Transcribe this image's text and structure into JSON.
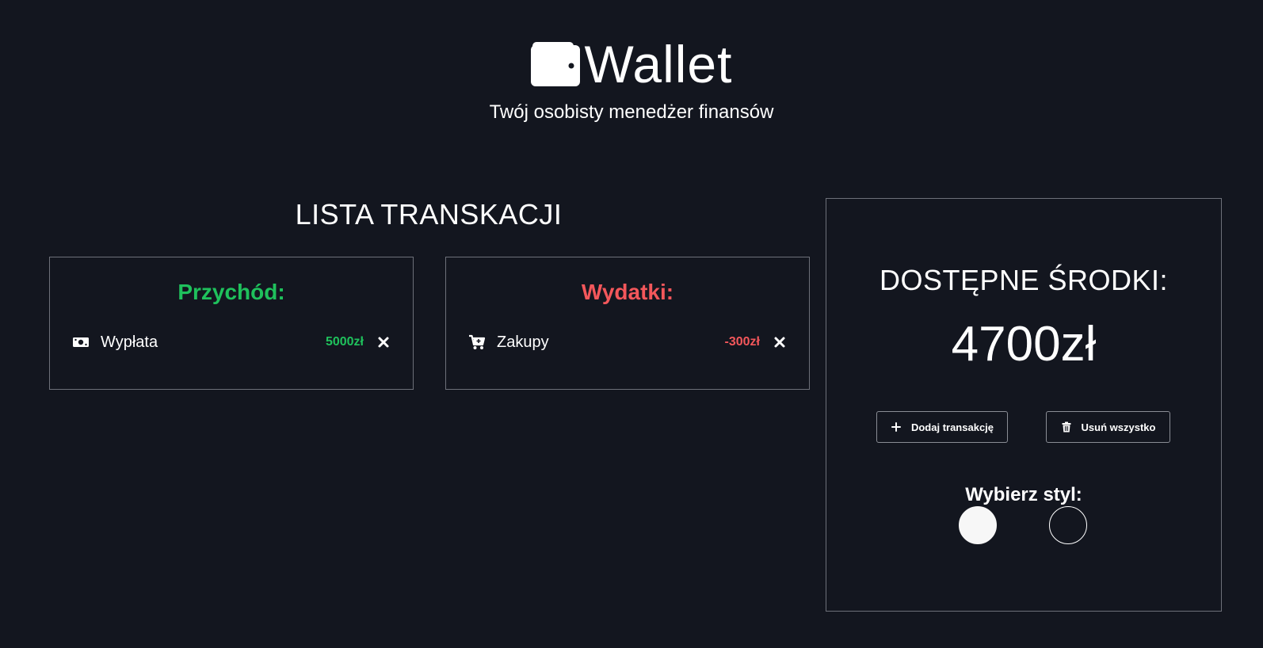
{
  "header": {
    "app_name": "Wallet",
    "subtitle": "Twój osobisty menedżer finansów",
    "logo_icon": "wallet-icon"
  },
  "transactions": {
    "title": "LISTA TRANSKACJI",
    "income": {
      "heading": "Przychód:",
      "color": "#1fc15c",
      "items": [
        {
          "icon": "money-bill-icon",
          "name": "Wypłata",
          "amount": "5000zł"
        }
      ]
    },
    "expenses": {
      "heading": "Wydatki:",
      "color": "#f3575b",
      "items": [
        {
          "icon": "shopping-cart-icon",
          "name": "Zakupy",
          "amount": "-300zł"
        }
      ]
    }
  },
  "balance": {
    "label": "DOSTĘPNE ŚRODKI:",
    "value": "4700zł",
    "add_button": {
      "label": "Dodaj transakcję",
      "icon": "plus-icon"
    },
    "clear_button": {
      "label": "Usuń wszystko",
      "icon": "trash-icon"
    },
    "style_label": "Wybierz styl:",
    "styles": [
      {
        "name": "light",
        "color": "#f7f7f7"
      },
      {
        "name": "dark",
        "color": "#13161f"
      }
    ]
  },
  "colors": {
    "background": "#13161f",
    "border": "#6d7079",
    "text": "#ffffff"
  }
}
